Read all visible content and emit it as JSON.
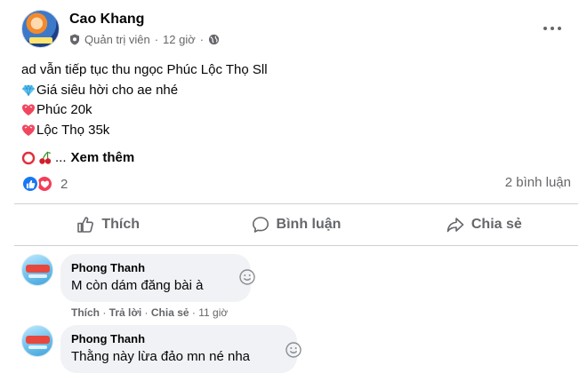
{
  "post": {
    "author": "Cao Khang",
    "role": "Quản trị viên",
    "time": "12 giờ",
    "lines": [
      "ad vẫn tiếp tục thu ngọc Phúc Lộc Thọ Sll",
      "Giá siêu hời cho ae nhé",
      "Phúc 20k",
      "Lộc Thọ 35k"
    ],
    "line_icons": [
      "",
      "diamond-icon",
      "heart-icon",
      "heart-icon"
    ],
    "see_more": "Xem thêm",
    "ellipsis": "..."
  },
  "reactions": {
    "count": "2",
    "comments_label": "2 bình luận"
  },
  "actions": {
    "like": "Thích",
    "comment": "Bình luận",
    "share": "Chia sẻ"
  },
  "comments": [
    {
      "name": "Phong Thanh",
      "text": "M còn dám đăng bài à",
      "like": "Thích",
      "reply": "Trả lời",
      "share": "Chia sẻ",
      "time": "11 giờ"
    },
    {
      "name": "Phong Thanh",
      "text": "Thằng này lừa đảo mn né nha"
    }
  ],
  "colors": {
    "text": "#050505",
    "secondary": "#65676b",
    "like_blue": "#1877f2",
    "love_red": "#f33e58",
    "bubble": "#f0f2f5"
  }
}
